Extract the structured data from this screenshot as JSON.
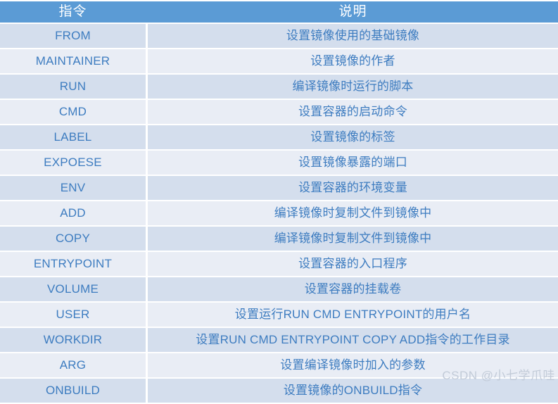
{
  "table": {
    "columns": [
      {
        "key": "command",
        "label": "指令"
      },
      {
        "key": "description",
        "label": "说明"
      }
    ],
    "rows": [
      {
        "command": "FROM",
        "description": "设置镜像使用的基础镜像"
      },
      {
        "command": "MAINTAINER",
        "description": "设置镜像的作者"
      },
      {
        "command": "RUN",
        "description": "编译镜像时运行的脚本"
      },
      {
        "command": "CMD",
        "description": "设置容器的启动命令"
      },
      {
        "command": "LABEL",
        "description": "设置镜像的标签"
      },
      {
        "command": "EXPOESE",
        "description": "设置镜像暴露的端口"
      },
      {
        "command": "ENV",
        "description": "设置容器的环境变量"
      },
      {
        "command": "ADD",
        "description": "编译镜像时复制文件到镜像中"
      },
      {
        "command": "COPY",
        "description": "编译镜像时复制文件到镜像中"
      },
      {
        "command": "ENTRYPOINT",
        "description": "设置容器的入口程序"
      },
      {
        "command": "VOLUME",
        "description": "设置容器的挂载卷"
      },
      {
        "command": "USER",
        "description": "设置运行RUN CMD ENTRYPOINT的用户名"
      },
      {
        "command": "WORKDIR",
        "description": "设置RUN CMD ENTRYPOINT COPY ADD指令的工作目录"
      },
      {
        "command": "ARG",
        "description": "设置编译镜像时加入的参数"
      },
      {
        "command": "ONBUILD",
        "description": "设置镜像的ONBUILD指令"
      }
    ]
  },
  "watermark": {
    "brand": "CSDN",
    "user": "@小七学爪哇"
  },
  "colors": {
    "header_background": "#5b9bd5",
    "header_text": "#ffffff",
    "row_odd_background": "#d4deed",
    "row_even_background": "#e9edf5",
    "cell_text": "#3d7cc0",
    "page_background": "#ffffff",
    "watermark_text": "#c2cbd8"
  }
}
